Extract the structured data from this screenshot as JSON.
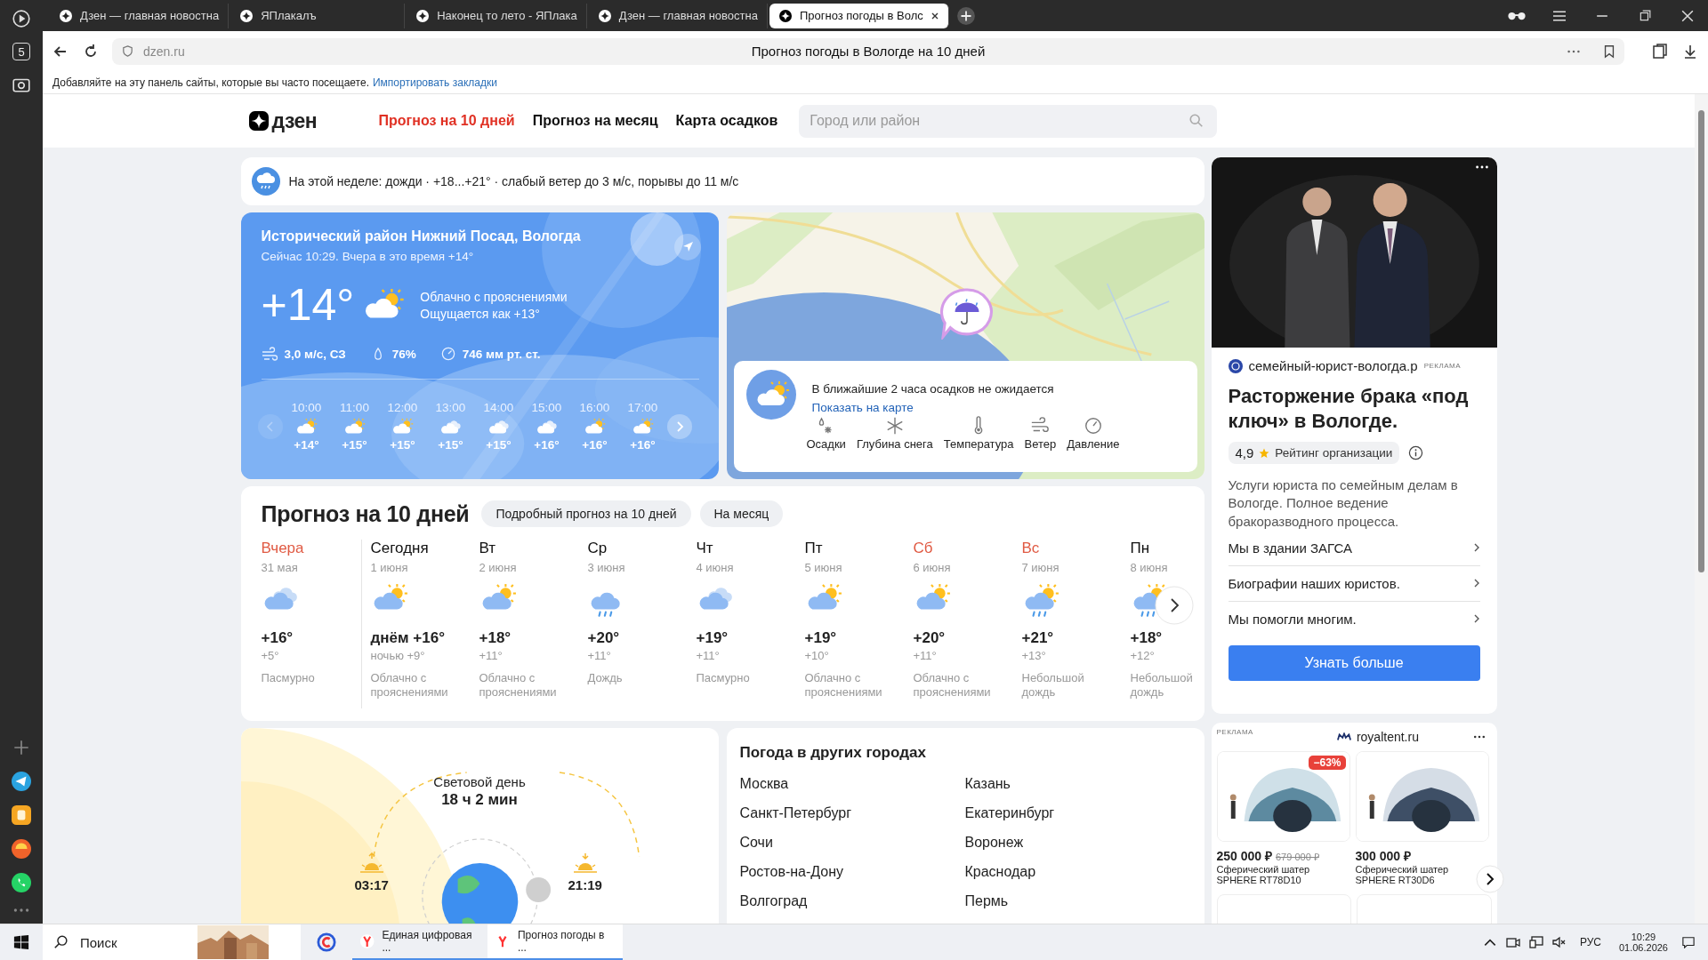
{
  "browser": {
    "tabs": [
      {
        "title": "Дзен — главная новостна",
        "selected": false
      },
      {
        "title": "ЯПлакалъ",
        "selected": false
      },
      {
        "title": "Наконец то лето - ЯПлака",
        "selected": false
      },
      {
        "title": "Дзен — главная новостна",
        "selected": false
      },
      {
        "title": "Прогноз погоды в Волс",
        "selected": true
      }
    ],
    "sidebar_badge": "5",
    "url": "dzen.ru",
    "page_title": "Прогноз погоды в Вологде на 10 дней",
    "bookmarks_hint": "Добавляйте на эту панель сайты, которые вы часто посещаете.",
    "bookmarks_link": "Импортировать закладки"
  },
  "header": {
    "logo": "дзен",
    "nav": [
      {
        "label": "Прогноз на 10 дней",
        "selected": true
      },
      {
        "label": "Прогноз на месяц",
        "selected": false
      },
      {
        "label": "Карта осадков",
        "selected": false
      }
    ],
    "search": {
      "placeholder": "Город или район"
    }
  },
  "summary": "На этой неделе: дожди · +18...+21° · слабый ветер до 3 м/с, порывы до 11 м/с",
  "now": {
    "location": "Исторический район Нижний Посад, Вологда",
    "subtitle": "Сейчас 10:29. Вчера в это время +14°",
    "temp": "+14°",
    "condition": "Облачно с прояснениями",
    "feels": "Ощущается как +13°",
    "wind": "3,0 м/с, СЗ",
    "humidity": "76%",
    "pressure": "746 мм рт. ст.",
    "hours": [
      {
        "time": "10:00",
        "kind": "partly",
        "temp": "+14°"
      },
      {
        "time": "11:00",
        "kind": "partly",
        "temp": "+15°"
      },
      {
        "time": "12:00",
        "kind": "partly",
        "temp": "+15°"
      },
      {
        "time": "13:00",
        "kind": "cloudy",
        "temp": "+15°"
      },
      {
        "time": "14:00",
        "kind": "cloudy",
        "temp": "+15°"
      },
      {
        "time": "15:00",
        "kind": "cloudy",
        "temp": "+16°"
      },
      {
        "time": "16:00",
        "kind": "partly",
        "temp": "+16°"
      },
      {
        "time": "17:00",
        "kind": "partly",
        "temp": "+16°"
      }
    ]
  },
  "nowcast": {
    "text": "В ближайшие 2 часа осадков не ожидается",
    "link": "Показать на карте",
    "layers": [
      {
        "kind": "precip",
        "label": "Осадки"
      },
      {
        "kind": "snow",
        "label": "Глубина снега"
      },
      {
        "kind": "temp",
        "label": "Температура"
      },
      {
        "kind": "wind",
        "label": "Ветер"
      },
      {
        "kind": "pressure",
        "label": "Давление"
      }
    ]
  },
  "forecast": {
    "title": "Прогноз на 10 дней",
    "buttons": [
      "Подробный прогноз на 10 дней",
      "На месяц"
    ],
    "days": [
      {
        "name": "Вчера",
        "date": "31 мая",
        "kind": "cloudy",
        "high": "+16°",
        "low": "+5°",
        "condition": "Пасмурно",
        "weekend": true
      },
      {
        "name": "Сегодня",
        "date": "1 июня",
        "kind": "partly",
        "high": "днём +16°",
        "low": "ночью +9°",
        "condition": "Облачно с прояснениями",
        "weekend": false
      },
      {
        "name": "Вт",
        "date": "2 июня",
        "kind": "partly",
        "high": "+18°",
        "low": "+11°",
        "condition": "Облачно с прояснениями",
        "weekend": false
      },
      {
        "name": "Ср",
        "date": "3 июня",
        "kind": "rain",
        "high": "+20°",
        "low": "+11°",
        "condition": "Дождь",
        "weekend": false
      },
      {
        "name": "Чт",
        "date": "4 июня",
        "kind": "cloudy",
        "high": "+19°",
        "low": "+11°",
        "condition": "Пасмурно",
        "weekend": false
      },
      {
        "name": "Пт",
        "date": "5 июня",
        "kind": "partly",
        "high": "+19°",
        "low": "+10°",
        "condition": "Облачно с прояснениями",
        "weekend": false
      },
      {
        "name": "Сб",
        "date": "6 июня",
        "kind": "partly",
        "high": "+20°",
        "low": "+11°",
        "condition": "Облачно с прояснениями",
        "weekend": true
      },
      {
        "name": "Вс",
        "date": "7 июня",
        "kind": "partly_rain",
        "high": "+21°",
        "low": "+13°",
        "condition": "Небольшой дождь",
        "weekend": true
      },
      {
        "name": "Пн",
        "date": "8 июня",
        "kind": "partly_rain",
        "high": "+18°",
        "low": "+12°",
        "condition": "Небольшой дождь",
        "weekend": false
      }
    ]
  },
  "daylight": {
    "label": "Световой день",
    "duration": "18 ч 2 мин",
    "sunrise": "03:17",
    "sunset": "21:19"
  },
  "cities": {
    "title": "Погода в других городах",
    "items": [
      "Москва",
      "Казань",
      "Санкт-Петербург",
      "Екатеринбург",
      "Сочи",
      "Воронеж",
      "Ростов-на-Дону",
      "Краснодар",
      "Волгоград",
      "Пермь"
    ]
  },
  "ad1": {
    "domain": "семейный-юрист-вологда.р",
    "label": "РЕКЛАМА",
    "title": "Расторжение брака «под ключ» в Вологде.",
    "rating": "4,9",
    "rating_label": "Рейтинг организации",
    "text": "Услуги юриста по семейным делам в Вологде. Полное ведение бракоразводного процесса.",
    "links": [
      "Мы в здании ЗАГСА",
      "Биографии наших юристов.",
      "Мы помогли многим."
    ],
    "button": "Узнать больше"
  },
  "ad2": {
    "label": "РЕКЛАМА",
    "domain": "royaltent.ru",
    "products": [
      {
        "discount": "−63%",
        "price": "250 000 ₽",
        "old_price": "679 000 ₽",
        "name": "Сферический шатер",
        "model": "SPHERE RT78D10"
      },
      {
        "price": "300 000 ₽",
        "name": "Сферический шатер",
        "model": "SPHERE RT30D6"
      }
    ]
  },
  "taskbar": {
    "search": {
      "placeholder": "Поиск"
    },
    "tasks": [
      {
        "label": "Единая цифровая ...",
        "selected": false
      },
      {
        "label": "Прогноз погоды в ...",
        "selected": true
      }
    ],
    "lang": "РУС",
    "time": "10:29",
    "date": "01.06.2026"
  }
}
